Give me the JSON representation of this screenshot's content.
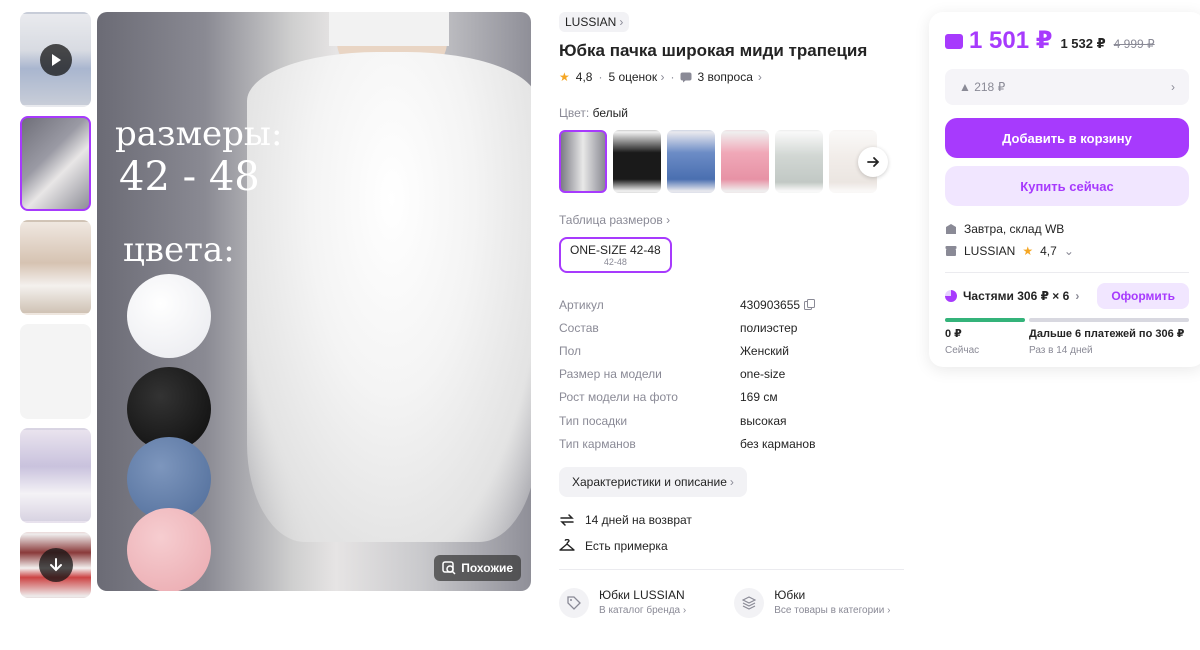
{
  "gallery": {
    "thumbnails": [
      {
        "name": "video",
        "has_play": true
      },
      {
        "name": "photo-2",
        "active": true
      },
      {
        "name": "photo-3"
      },
      {
        "name": "photo-4"
      },
      {
        "name": "photo-5"
      },
      {
        "name": "photo-6",
        "has_scroll_down": true
      }
    ],
    "overlay": {
      "sizes_label": "размеры:",
      "sizes_value": "42 - 48",
      "colors_label": "цвета:"
    },
    "similar_label": "Похожие"
  },
  "product": {
    "brand": "LUSSIAN",
    "title": "Юбка пачка широкая миди трапеция",
    "rating": "4,8",
    "reviews": "5 оценок",
    "questions": "3 вопроса",
    "color_label": "Цвет:",
    "color_value": "белый",
    "size_table_label": "Таблица размеров",
    "size_chip_main": "ONE-SIZE 42-48",
    "size_chip_sub": "42-48",
    "specs": [
      {
        "k": "Артикул",
        "v": "430903655"
      },
      {
        "k": "Состав",
        "v": "полиэстер"
      },
      {
        "k": "Пол",
        "v": "Женский"
      },
      {
        "k": "Размер на модели",
        "v": "one-size"
      },
      {
        "k": "Рост модели на фото",
        "v": "169 см"
      },
      {
        "k": "Тип посадки",
        "v": "высокая"
      },
      {
        "k": "Тип карманов",
        "v": "без карманов"
      }
    ],
    "description_button": "Характеристики и описание",
    "return_text": "14 дней на возврат",
    "fitting_text": "Есть примерка",
    "links": [
      {
        "title": "Юбки LUSSIAN",
        "sub": "В каталог бренда"
      },
      {
        "title": "Юбки",
        "sub": "Все товары в категории"
      }
    ]
  },
  "card": {
    "price": "1 501 ₽",
    "price_alt": "1 532 ₽",
    "price_old": "4 999 ₽",
    "box_value": "▲ 218 ₽",
    "add_to_cart": "Добавить в корзину",
    "buy_now": "Купить сейчас",
    "delivery": "Завтра, склад WB",
    "seller": "LUSSIAN",
    "seller_rating": "4,7",
    "installments": "Частями 306 ₽ × 6",
    "order_button": "Оформить",
    "pay_now_amount": "0 ₽",
    "pay_now_label": "Сейчас",
    "pay_later_amount": "Дальше 6 платежей по 306 ₽",
    "pay_later_label": "Раз в 14 дней",
    "paid_fraction": 0.0
  },
  "colors": {
    "accent": "#a73afd",
    "accent_light": "#f1e6ff",
    "green": "#34b37a",
    "star": "#f5a623"
  }
}
